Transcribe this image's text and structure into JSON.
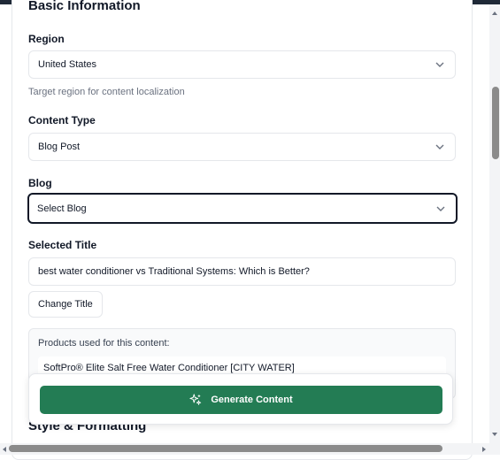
{
  "sections": {
    "basic_info_title": "Basic Information",
    "style_title": "Style & Formatting"
  },
  "region": {
    "label": "Region",
    "value": "United States",
    "helper": "Target region for content localization"
  },
  "content_type": {
    "label": "Content Type",
    "value": "Blog Post"
  },
  "blog": {
    "label": "Blog",
    "value": "Select Blog"
  },
  "selected_title": {
    "label": "Selected Title",
    "value": "best water conditioner vs Traditional Systems: Which is Better?",
    "change_button": "Change Title"
  },
  "products": {
    "label": "Products used for this content:",
    "items": [
      "SoftPro® Elite Salt Free Water Conditioner [CITY WATER]"
    ]
  },
  "generate": {
    "label": "Generate Content",
    "color": "#237c54"
  },
  "icons": {
    "chevron": "chevron-down-icon",
    "sparkles": "sparkles-icon"
  }
}
